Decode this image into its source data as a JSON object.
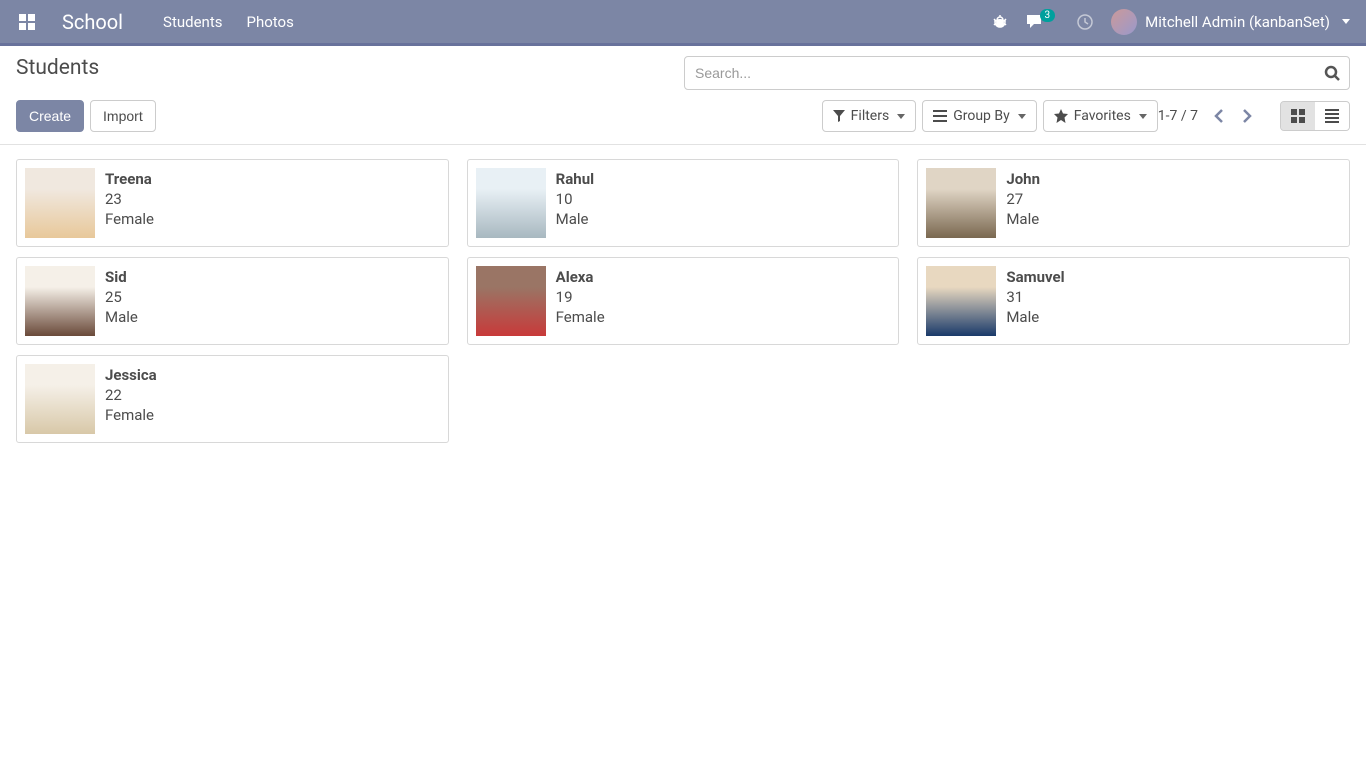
{
  "nav": {
    "brand": "School",
    "links": [
      "Students",
      "Photos"
    ],
    "messages_count": "3",
    "user_name": "Mitchell Admin (kanbanSet)"
  },
  "control": {
    "title": "Students",
    "create_label": "Create",
    "import_label": "Import",
    "search_placeholder": "Search...",
    "filters_label": "Filters",
    "groupby_label": "Group By",
    "favorites_label": "Favorites",
    "pager": "1-7 / 7"
  },
  "students": [
    {
      "name": "Treena",
      "age": "23",
      "gender": "Female",
      "img": "f1"
    },
    {
      "name": "Rahul",
      "age": "10",
      "gender": "Male",
      "img": "m1"
    },
    {
      "name": "John",
      "age": "27",
      "gender": "Male",
      "img": "m3"
    },
    {
      "name": "Sid",
      "age": "25",
      "gender": "Male",
      "img": "m2"
    },
    {
      "name": "Alexa",
      "age": "19",
      "gender": "Female",
      "img": "f2"
    },
    {
      "name": "Samuvel",
      "age": "31",
      "gender": "Male",
      "img": "m4"
    },
    {
      "name": "Jessica",
      "age": "22",
      "gender": "Female",
      "img": "f3"
    }
  ]
}
